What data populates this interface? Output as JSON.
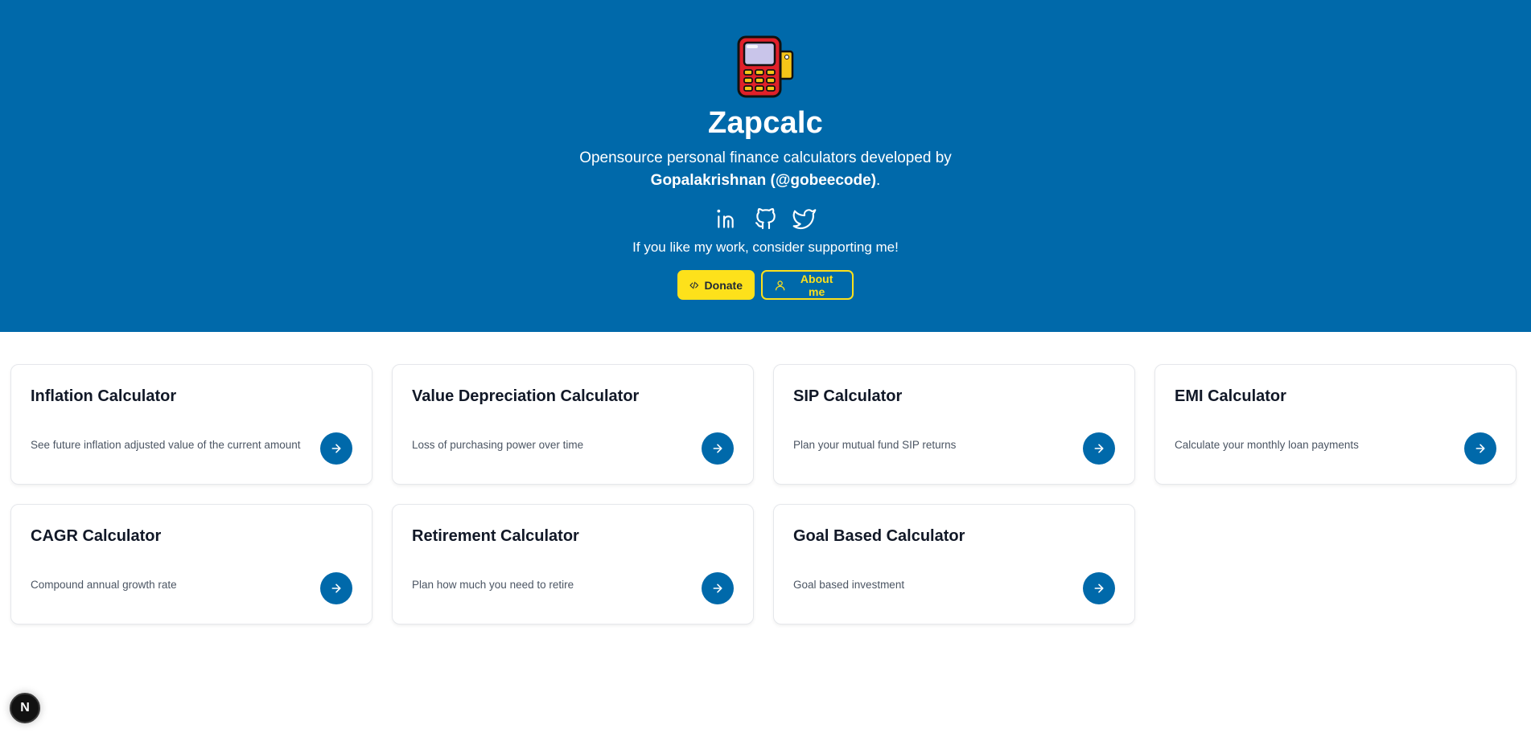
{
  "hero": {
    "title": "Zapcalc",
    "subtitle_line1": "Opensource personal finance calculators developed by",
    "author": "Gopalakrishnan (@gobeecode)",
    "author_suffix": ".",
    "socials": [
      "linkedin-icon",
      "github-icon",
      "twitter-icon"
    ],
    "support_text": "If you like my work, consider supporting me!",
    "donate_label": "Donate",
    "about_label": "About me",
    "colors": {
      "background": "#0069aa",
      "accent": "#fde11b"
    }
  },
  "cards": [
    {
      "title": "Inflation Calculator",
      "description": "See future inflation adjusted value of the current amount"
    },
    {
      "title": "Value Depreciation Calculator",
      "description": "Loss of purchasing power over time"
    },
    {
      "title": "SIP Calculator",
      "description": "Plan your mutual fund SIP returns"
    },
    {
      "title": "EMI Calculator",
      "description": "Calculate your monthly loan payments"
    },
    {
      "title": "CAGR Calculator",
      "description": "Compound annual growth rate"
    },
    {
      "title": "Retirement Calculator",
      "description": "Plan how much you need to retire"
    },
    {
      "title": "Goal Based Calculator",
      "description": "Goal based investment"
    }
  ],
  "dev_badge": {
    "label": "N"
  }
}
